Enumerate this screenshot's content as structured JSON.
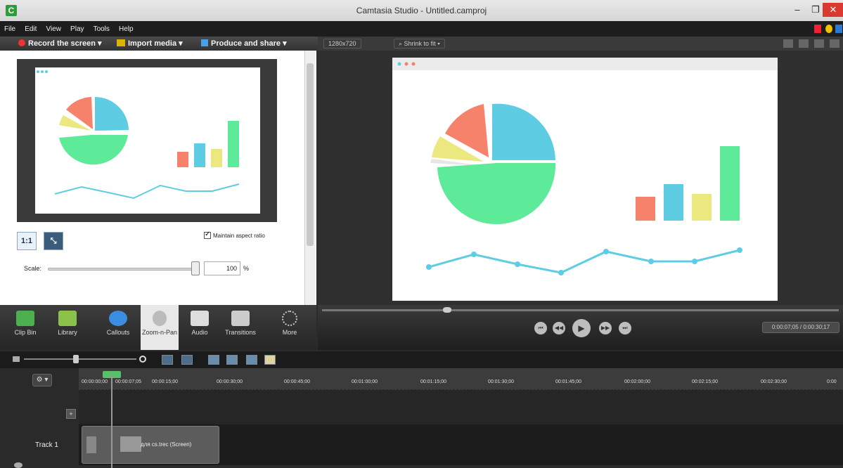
{
  "window": {
    "title": "Camtasia Studio - Untitled.camproj",
    "app_icon": "C"
  },
  "menu": [
    "File",
    "Edit",
    "View",
    "Play",
    "Tools",
    "Help"
  ],
  "toolbar": {
    "record": "Record the screen ▾",
    "import": "Import media ▾",
    "produce": "Produce and share ▾"
  },
  "preview_bar": {
    "dimensions": "1280x720",
    "zoom": "Shrink to fit"
  },
  "left_panel": {
    "maintain_aspect": "Maintain aspect ratio",
    "scale_label": "Scale:",
    "scale_value": "100",
    "percent": "%",
    "btn_1to1": "1:1"
  },
  "tabs": [
    {
      "label": "Clip Bin",
      "icon": "clip-bin-icon",
      "color": "#4caf50"
    },
    {
      "label": "Library",
      "icon": "library-icon",
      "color": "#8bc34a"
    },
    {
      "label": "Callouts",
      "icon": "callouts-icon",
      "color": "#3b8de0"
    },
    {
      "label": "Zoom-n-Pan",
      "icon": "zoom-icon",
      "color": "#999999"
    },
    {
      "label": "Audio",
      "icon": "audio-icon",
      "color": "#cccccc"
    },
    {
      "label": "Transitions",
      "icon": "transitions-icon",
      "color": "#cccccc"
    },
    {
      "label": "More",
      "icon": "more-icon",
      "color": "#cccccc"
    }
  ],
  "player": {
    "timecode": "0:00:07;05 / 0:00:30;17"
  },
  "timeline": {
    "ruler": [
      "00:00:00;00",
      "00:00:07;05",
      "00:00:15;00",
      "00:00:30;00",
      "00:00:45;00",
      "00:01:00;00",
      "00:01:15;00",
      "00:01:30;00",
      "00:01:45;00",
      "00:02:00;00",
      "00:02:15;00",
      "00:02:30;00",
      "0:00"
    ],
    "track_label": "Track 1",
    "clip_label": "для cs.trec (Screen)"
  },
  "colors": {
    "salmon": "#f7826b",
    "blue": "#5ecde3",
    "yellow": "#ece880",
    "green": "#5deb99",
    "gray": "#e6e6e6",
    "line": "#5ecde3"
  }
}
